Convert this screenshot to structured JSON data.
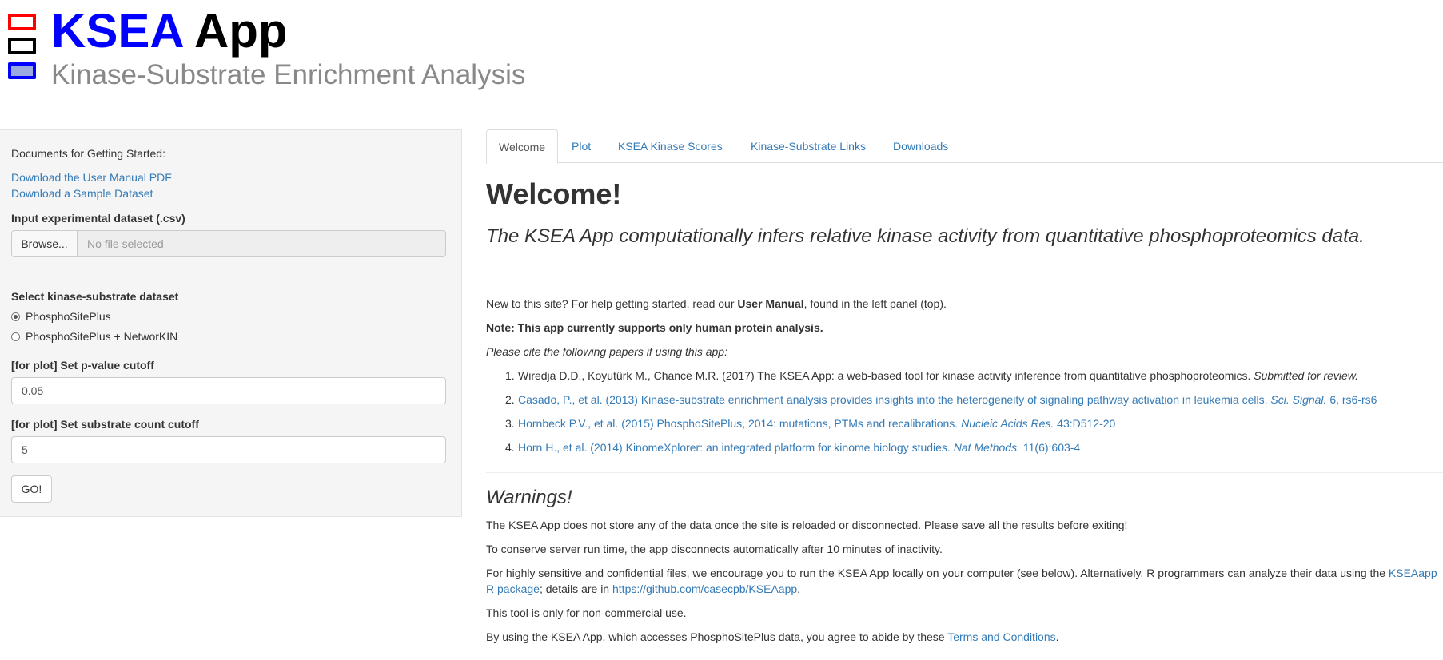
{
  "header": {
    "title_part1": "KSEA",
    "title_part2": "App",
    "subtitle": "Kinase-Substrate Enrichment Analysis"
  },
  "sidebar": {
    "docs_heading": "Documents for Getting Started:",
    "link_manual": "Download the User Manual PDF",
    "link_sample": "Download a Sample Dataset",
    "input_label": "Input experimental dataset (.csv)",
    "browse_label": "Browse...",
    "file_placeholder": "No file selected",
    "dataset_label": "Select kinase-substrate dataset",
    "radio_options": [
      "PhosphoSitePlus",
      "PhosphoSitePlus + NetworKIN"
    ],
    "radio_selected": "PhosphoSitePlus",
    "pvalue_label": "[for plot] Set p-value cutoff",
    "pvalue_value": "0.05",
    "count_label": "[for plot] Set substrate count cutoff",
    "count_value": "5",
    "go_label": "GO!"
  },
  "tabs": [
    {
      "label": "Welcome",
      "active": true
    },
    {
      "label": "Plot",
      "active": false
    },
    {
      "label": "KSEA Kinase Scores",
      "active": false
    },
    {
      "label": "Kinase-Substrate Links",
      "active": false
    },
    {
      "label": "Downloads",
      "active": false
    }
  ],
  "main": {
    "title": "Welcome!",
    "lead": "The KSEA App computationally infers relative kinase activity from quantitative phosphoproteomics data.",
    "intro_pre": "New to this site? For help getting started, read our ",
    "intro_bold": "User Manual",
    "intro_post": ", found in the left panel (top).",
    "note": "Note: This app currently supports only human protein analysis.",
    "cite_intro": "Please cite the following papers if using this app:",
    "refs": [
      {
        "num": "1.",
        "text": "Wiredja D.D., Koyutürk M., Chance M.R. (2017) The KSEA App: a web-based tool for kinase activity inference from quantitative phosphoproteomics. ",
        "italic": "Submitted for review.",
        "tail": ""
      },
      {
        "num": "2.",
        "text": "Casado, P., et al. (2013) Kinase-substrate enrichment analysis provides insights into the heterogeneity of signaling pathway activation in leukemia cells. ",
        "italic": "Sci. Signal.",
        "tail": " 6, rs6-rs6"
      },
      {
        "num": "3.",
        "text": "Hornbeck P.V., et al. (2015) PhosphoSitePlus, 2014: mutations, PTMs and recalibrations. ",
        "italic": "Nucleic Acids Res.",
        "tail": " 43:D512-20"
      },
      {
        "num": "4.",
        "text": "Horn H., et al. (2014) KinomeXplorer: an integrated platform for kinome biology studies. ",
        "italic": "Nat Methods.",
        "tail": " 11(6):603-4"
      }
    ],
    "warnings_title": "Warnings!",
    "warn1": "The KSEA App does not store any of the data once the site is reloaded or disconnected. Please save all the results before exiting!",
    "warn2": "To conserve server run time, the app disconnects automatically after 10 minutes of inactivity.",
    "warn3_pre": "For highly sensitive and confidential files, we encourage you to run the KSEA App locally on your computer (see below). Alternatively, R programmers can analyze their data using the ",
    "warn3_link1": "KSEAapp R package",
    "warn3_mid": "; details are in ",
    "warn3_link2": "https://github.com/casecpb/KSEAapp",
    "warn3_post": ".",
    "warn4": "This tool is only for non-commercial use.",
    "warn5_pre": "By using the KSEA App, which accesses PhosphoSitePlus data, you agree to abide by these ",
    "warn5_link": "Terms and Conditions",
    "warn5_post": "."
  },
  "colors": {
    "link": "#337ab7",
    "title_blue": "#0000ff",
    "logo_red": "#ff0000",
    "logo_black": "#000000",
    "logo_blue": "#0000ff"
  }
}
